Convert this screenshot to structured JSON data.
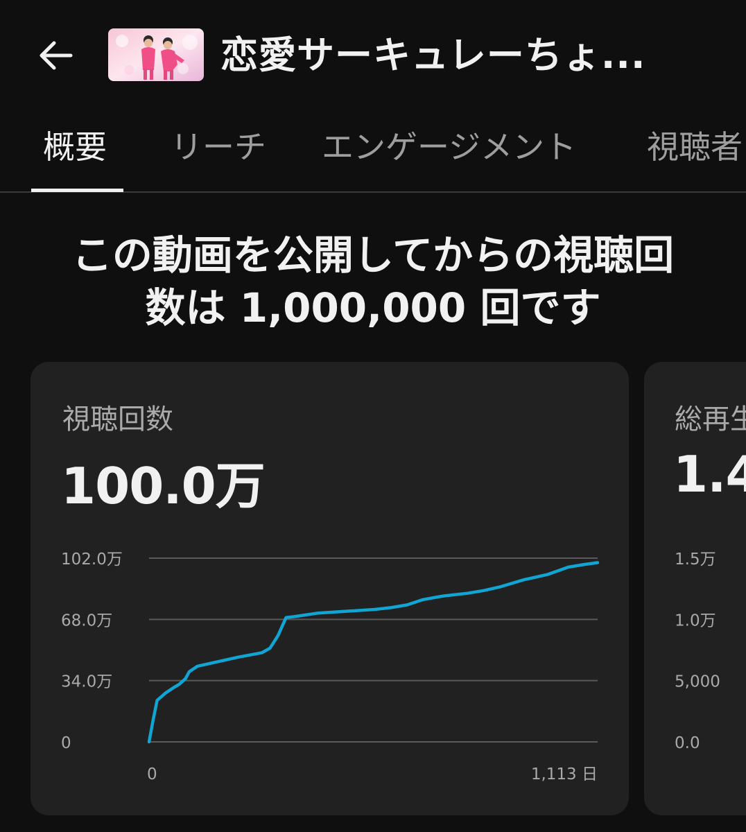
{
  "header": {
    "back_icon": "arrow-left-icon",
    "video_title": "恋愛サーキュレーちょ..."
  },
  "tabs": [
    {
      "label": "概要",
      "active": true
    },
    {
      "label": "リーチ",
      "active": false
    },
    {
      "label": "エンゲージメント",
      "active": false
    },
    {
      "label": "視聴者",
      "active": false
    }
  ],
  "headline": {
    "line1": "この動画を公開してからの視聴回",
    "line2": "数は 1,000,000 回です"
  },
  "cards": [
    {
      "label": "視聴回数",
      "value": "100.0万"
    },
    {
      "label": "総再生",
      "value": "1.4"
    }
  ],
  "colors": {
    "accent_line": "#11a5d3",
    "background": "#0f0f0f",
    "card": "#212121"
  },
  "chart_data": [
    {
      "type": "line",
      "title": "視聴回数",
      "xlabel": "",
      "ylabel": "",
      "x_tick_labels": [
        "0",
        "1,113 日"
      ],
      "y_tick_labels": [
        "0",
        "34.0万",
        "68.0万",
        "102.0万"
      ],
      "xlim": [
        0,
        1113
      ],
      "ylim": [
        0,
        1020000
      ],
      "grid": true,
      "series": [
        {
          "x": [
            0,
            10,
            20,
            40,
            60,
            75,
            90,
            100,
            120,
            140,
            170,
            220,
            280,
            300,
            320,
            340,
            360,
            420,
            490,
            560,
            600,
            640,
            680,
            730,
            790,
            830,
            870,
            900,
            930,
            990,
            1040,
            1080,
            1113
          ],
          "values": [
            0,
            120000,
            230000,
            270000,
            300000,
            320000,
            350000,
            390000,
            420000,
            430000,
            445000,
            470000,
            495000,
            520000,
            590000,
            690000,
            695000,
            715000,
            725000,
            735000,
            745000,
            760000,
            790000,
            810000,
            825000,
            840000,
            860000,
            880000,
            900000,
            930000,
            970000,
            985000,
            995000
          ]
        }
      ]
    },
    {
      "type": "line",
      "title": "総再生",
      "y_tick_labels": [
        "0.0",
        "5,000",
        "1.0万",
        "1.5万"
      ],
      "ylim": [
        0,
        15000
      ],
      "grid": true,
      "series": []
    }
  ]
}
